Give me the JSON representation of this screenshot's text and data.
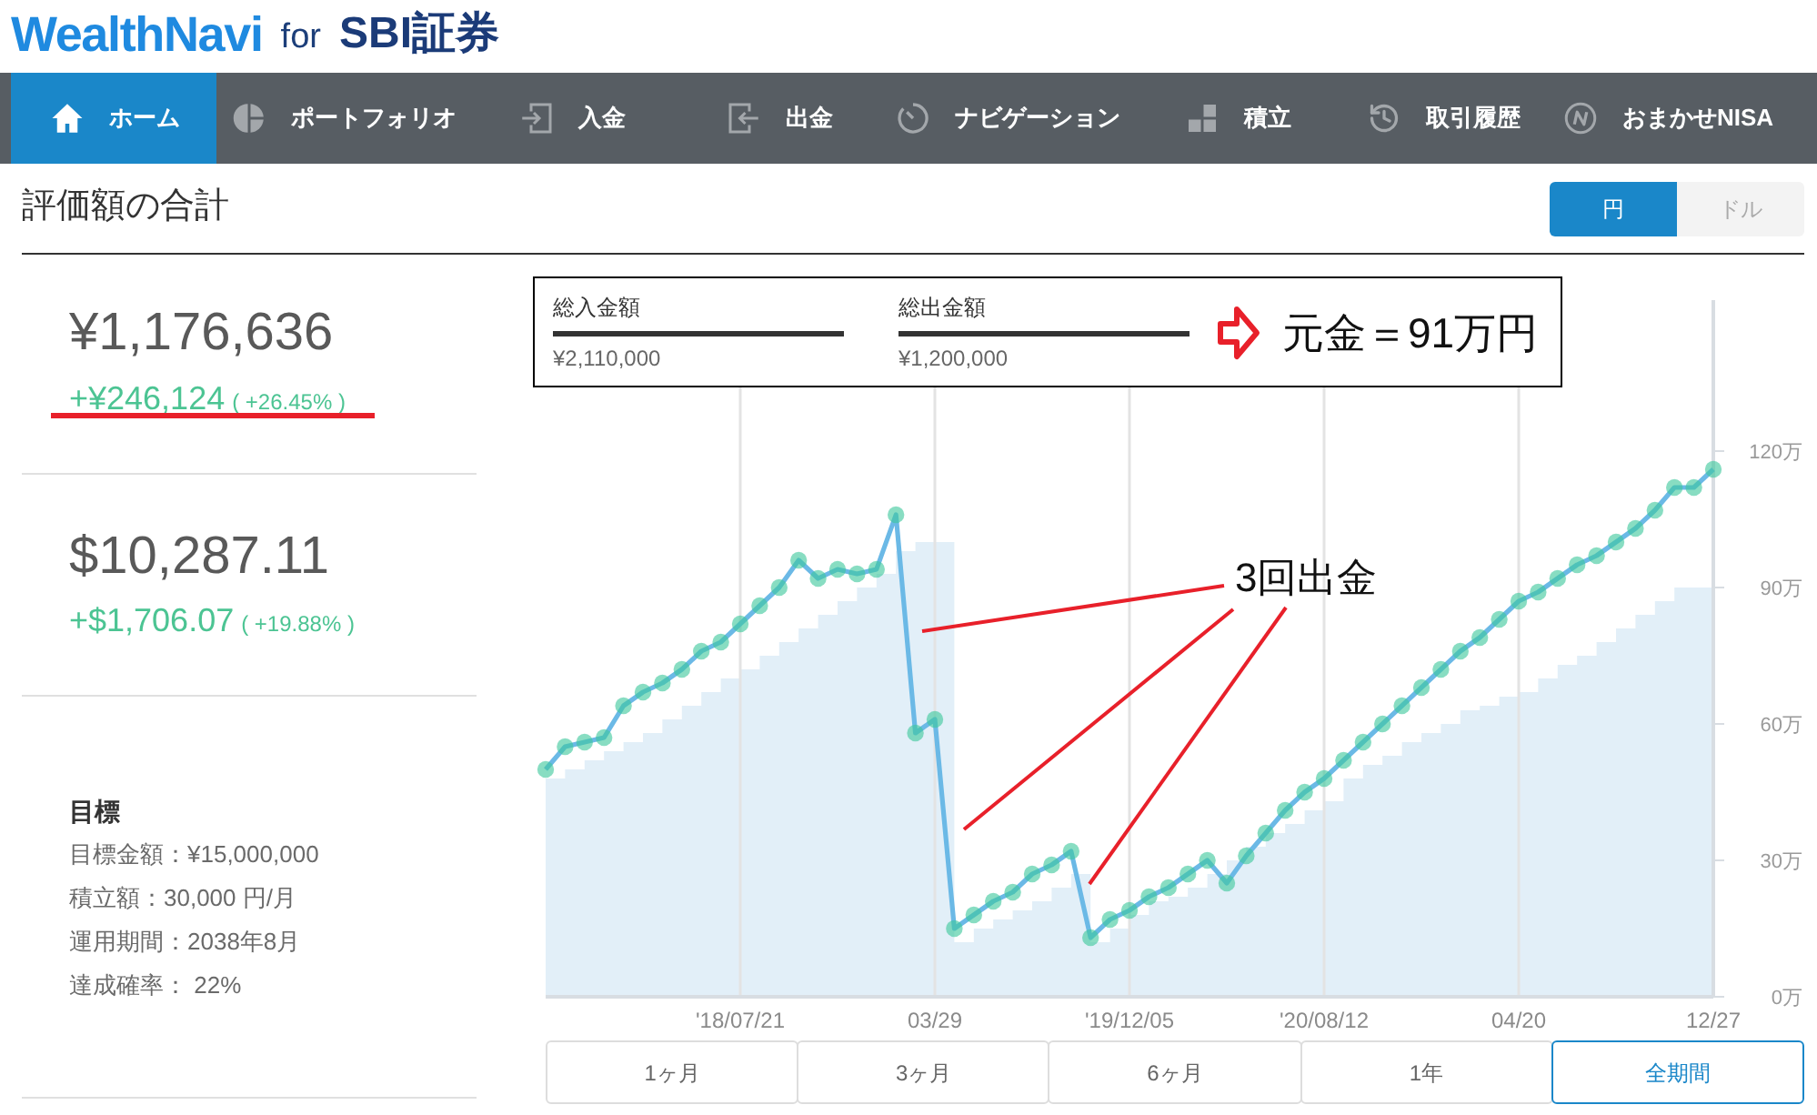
{
  "header": {
    "brand": "WealthNavi",
    "connector": "for",
    "partner": "SBI証券"
  },
  "nav": [
    {
      "label": "ホーム",
      "selected": true
    },
    {
      "label": "ポートフォリオ",
      "selected": false
    },
    {
      "label": "入金",
      "selected": false
    },
    {
      "label": "出金",
      "selected": false
    },
    {
      "label": "ナビゲーション",
      "selected": false
    },
    {
      "label": "積立",
      "selected": false
    },
    {
      "label": "取引履歴",
      "selected": false
    },
    {
      "label": "おまかせNISA",
      "selected": false
    }
  ],
  "title": "評価額の合計",
  "currency_toggle": [
    {
      "label": "円",
      "selected": true
    },
    {
      "label": "ドル",
      "selected": false
    }
  ],
  "summary": [
    {
      "amount": "¥1,176,636",
      "gain": "+¥246,124",
      "gain_percent": "( +26.45% )",
      "highlighted": true
    },
    {
      "amount": "$10,287.11",
      "gain": "+$1,706.07",
      "gain_percent": "( +19.88% )",
      "highlighted": false
    }
  ],
  "goal": {
    "heading": "目標",
    "details": [
      "目標金額：¥15,000,000",
      "積立額：30,000 円/月",
      "運用期間：2038年8月",
      "達成確率： 22%"
    ]
  },
  "chart": {
    "chart_data": {
      "type": "line",
      "grid": true,
      "categories": [
        null,
        null,
        null,
        null,
        null,
        null,
        null,
        null,
        null,
        null,
        "'18/07/21",
        null,
        null,
        null,
        null,
        null,
        null,
        null,
        null,
        null,
        "03/29",
        null,
        null,
        null,
        null,
        null,
        null,
        null,
        null,
        null,
        "'19/12/05",
        null,
        null,
        null,
        null,
        null,
        null,
        null,
        null,
        null,
        "'20/08/12",
        null,
        null,
        null,
        null,
        null,
        null,
        null,
        null,
        null,
        "04/20",
        null,
        null,
        null,
        null,
        null,
        null,
        null,
        null,
        null,
        "12/27"
      ],
      "series": [
        {
          "type": "line",
          "marker": "circle",
          "color": "#6bb9e6",
          "values": [
            50,
            55,
            56,
            57,
            64,
            67,
            69,
            72,
            76,
            78,
            82,
            86,
            90,
            96,
            92,
            94,
            93,
            94,
            106,
            58,
            61,
            15,
            18,
            21,
            23,
            27,
            29,
            32,
            13,
            17,
            19,
            22,
            24,
            27,
            30,
            25,
            31,
            36,
            41,
            45,
            48,
            52,
            56,
            60,
            64,
            68,
            72,
            76,
            79,
            83,
            87,
            89,
            92,
            95,
            97,
            100,
            103,
            107,
            112,
            112,
            116
          ]
        },
        {
          "type": "area",
          "color": "#e2eff8",
          "values": [
            48,
            50,
            52,
            54,
            56,
            58,
            61,
            64,
            67,
            70,
            72,
            75,
            78,
            81,
            84,
            87,
            90,
            93,
            98,
            100,
            100,
            12,
            15,
            17,
            19,
            21,
            24,
            27,
            12,
            15,
            18,
            21,
            22,
            24,
            27,
            30,
            33,
            36,
            38,
            41,
            43,
            48,
            51,
            53,
            56,
            58,
            60,
            63,
            64,
            66,
            67,
            70,
            73,
            75,
            78,
            81,
            84,
            87,
            90,
            90,
            93
          ]
        }
      ],
      "ylim": [
        0,
        153.2
      ],
      "yticks": [
        {
          "value": 0,
          "label": "0万"
        },
        {
          "value": 30,
          "label": "30万"
        },
        {
          "value": 60,
          "label": "60万"
        },
        {
          "value": 90,
          "label": "90万"
        },
        {
          "value": 120,
          "label": "120万"
        }
      ]
    }
  },
  "annotation_box": {
    "items": [
      {
        "label": "総入金額",
        "value": "¥2,110,000"
      },
      {
        "label": "総出金額",
        "value": "¥1,200,000"
      }
    ],
    "note": "元金＝91万円"
  },
  "callout": {
    "label": "3回出金"
  },
  "range_buttons": [
    {
      "label": "1ヶ月",
      "selected": false
    },
    {
      "label": "3ヶ月",
      "selected": false
    },
    {
      "label": "6ヶ月",
      "selected": false
    },
    {
      "label": "1年",
      "selected": false
    },
    {
      "label": "全期間",
      "selected": true
    }
  ]
}
